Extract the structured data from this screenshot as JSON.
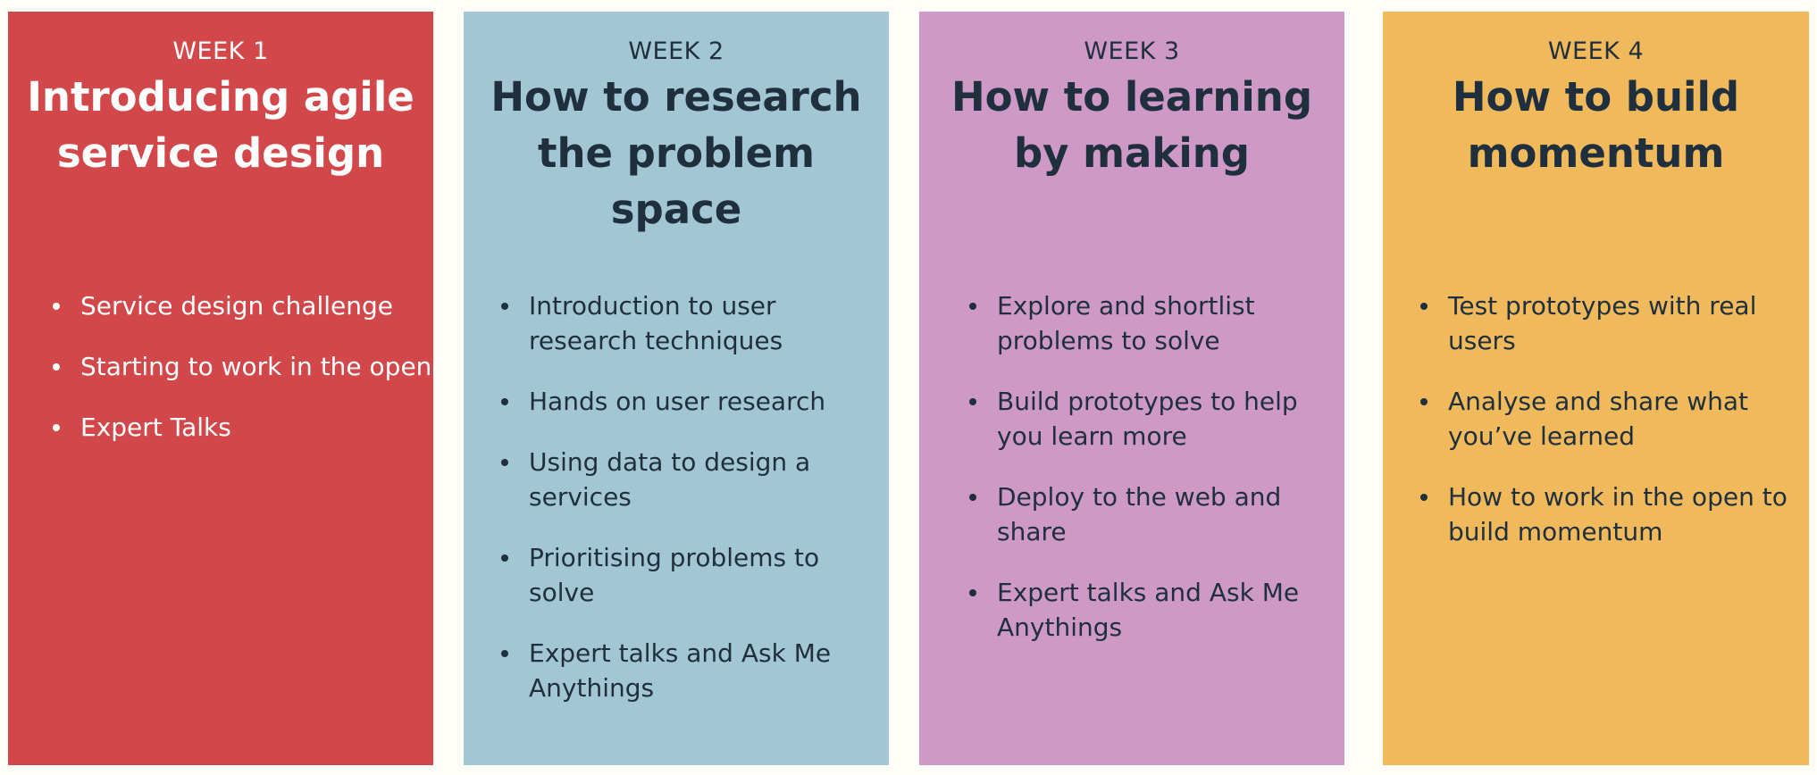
{
  "weeks": [
    {
      "label": "WEEK 1",
      "title": "Introducing agile service design",
      "bg": "#d2484a",
      "fg": "#ffffff",
      "items": [
        "Service design challenge",
        "Starting to work in the open",
        "Expert Talks"
      ]
    },
    {
      "label": "WEEK 2",
      "title": "How to research the problem space",
      "bg": "#a3c6d5",
      "fg": "#1f2f3d",
      "items": [
        "Introduction to user research techniques",
        "Hands on user research",
        "Using data to design a services",
        "Prioritising problems to solve",
        "Expert talks and Ask Me Anythings"
      ]
    },
    {
      "label": "WEEK 3",
      "title": "How to learning by making",
      "bg": "#ce99c6",
      "fg": "#1f2f3d",
      "items": [
        "Explore and shortlist problems to solve",
        "Build prototypes to help you learn more",
        "Deploy to the web and share",
        "Expert talks and Ask Me Anythings"
      ]
    },
    {
      "label": "WEEK 4",
      "title": "How to build momentum",
      "bg": "#f0b95c",
      "fg": "#1f2f3d",
      "items": [
        "Test prototypes with real users",
        "Analyse and share what you’ve learned",
        "How to work in the open to build momentum"
      ]
    }
  ]
}
